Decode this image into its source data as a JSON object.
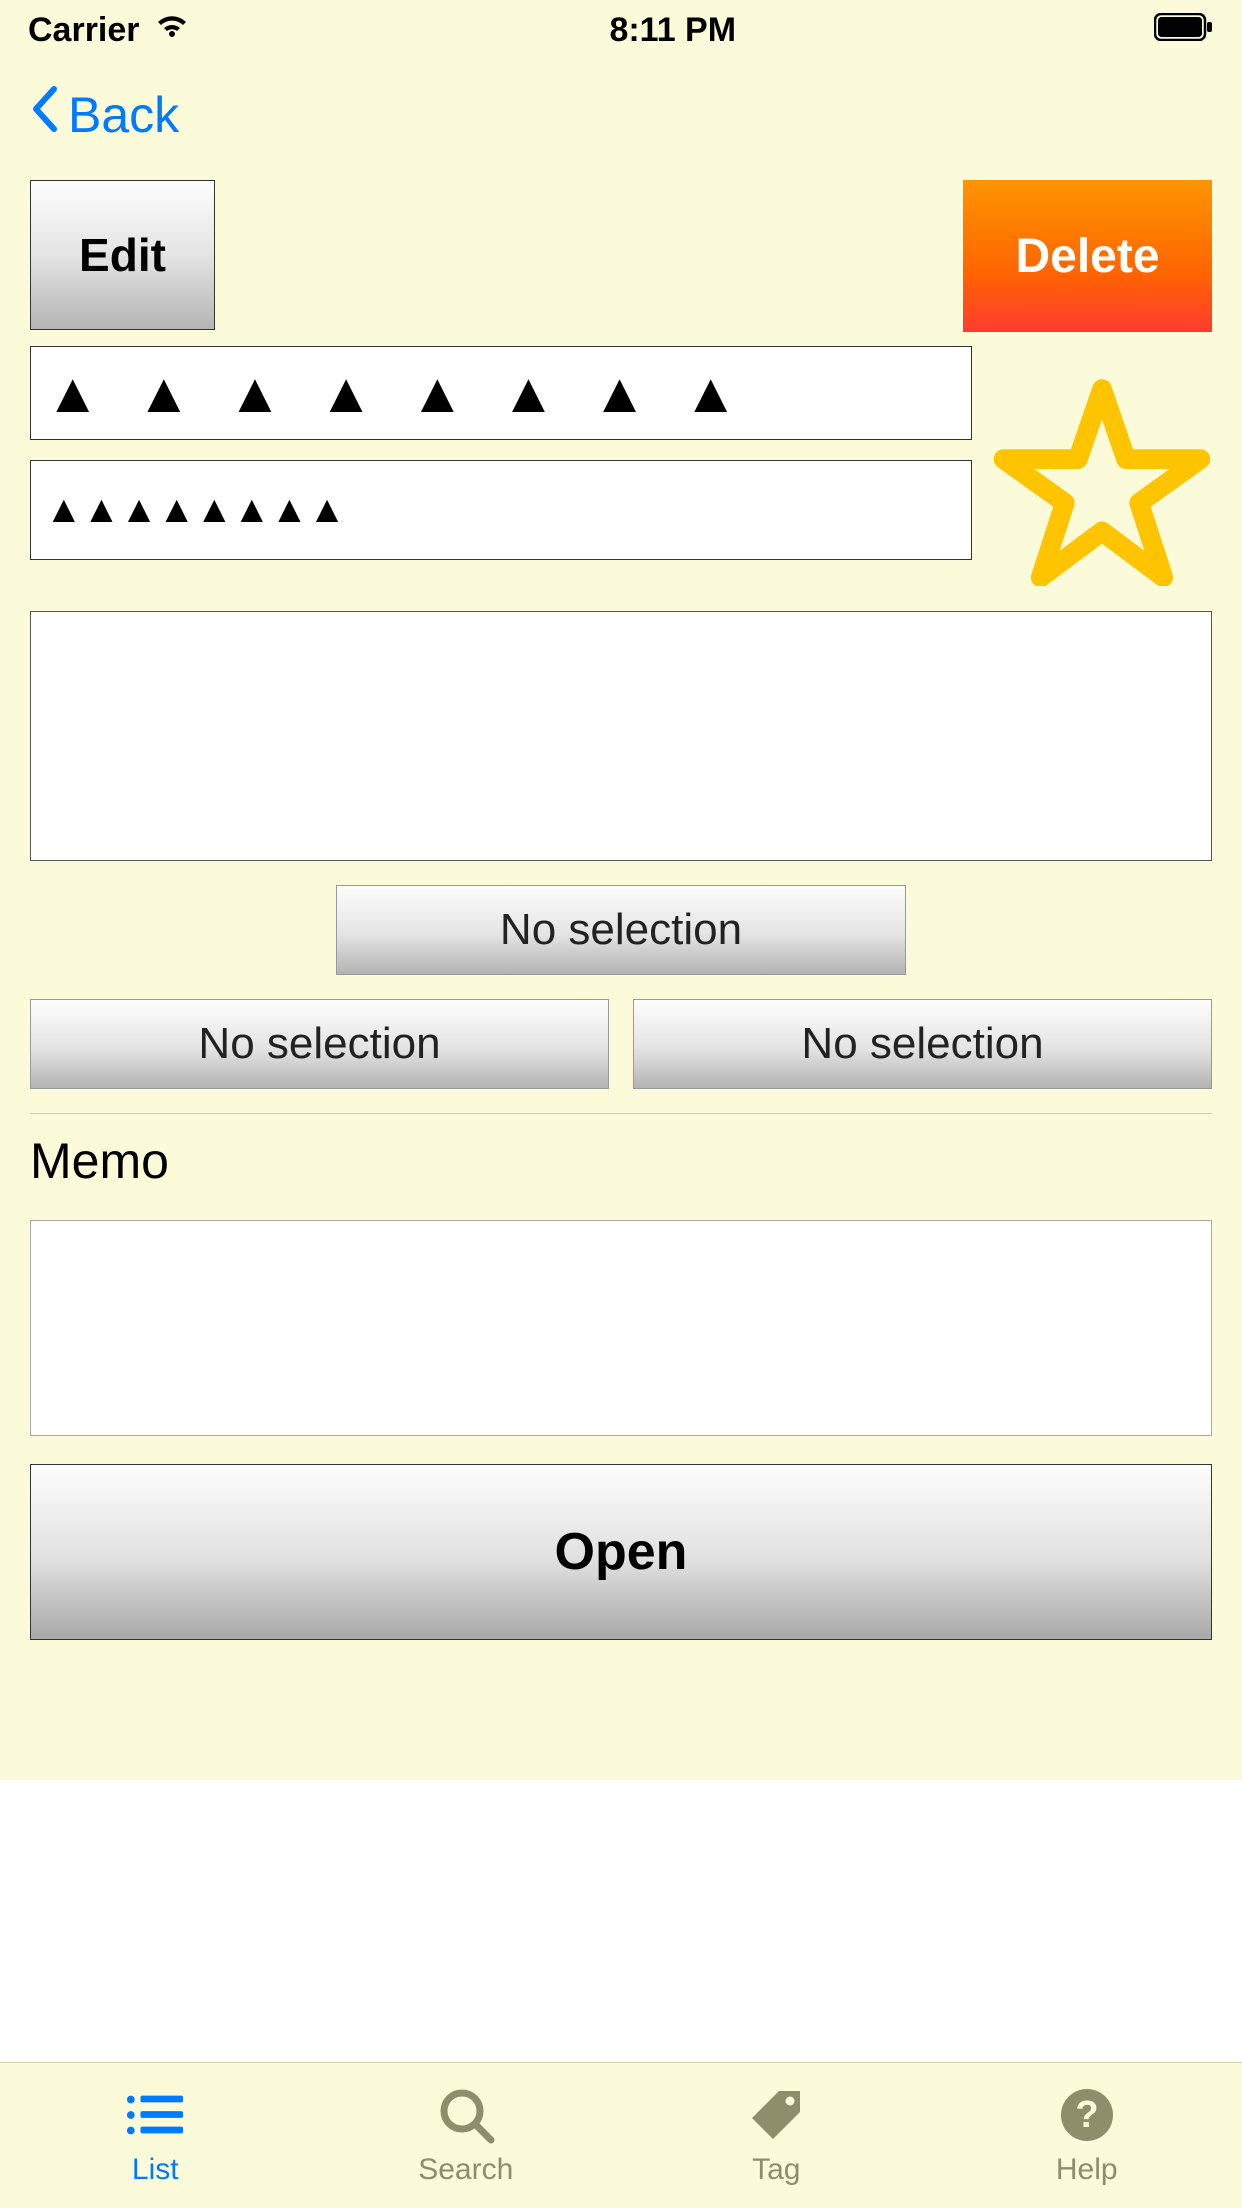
{
  "status": {
    "carrier": "Carrier",
    "time": "8:11 PM"
  },
  "nav": {
    "back": "Back"
  },
  "buttons": {
    "edit": "Edit",
    "delete": "Delete",
    "open": "Open"
  },
  "fields": {
    "line1": "▲ ▲ ▲ ▲ ▲ ▲ ▲ ▲",
    "line2": "▲▲▲▲▲▲▲▲"
  },
  "selections": {
    "top": "No selection",
    "left": "No selection",
    "right": "No selection"
  },
  "memo": {
    "label": "Memo"
  },
  "tabs": {
    "list": "List",
    "search": "Search",
    "tag": "Tag",
    "help": "Help"
  },
  "colors": {
    "accent": "#007aff",
    "bg": "#fbfad9",
    "star": "#ffc400",
    "delete_from": "#ff9500",
    "delete_to": "#ff3b30"
  }
}
